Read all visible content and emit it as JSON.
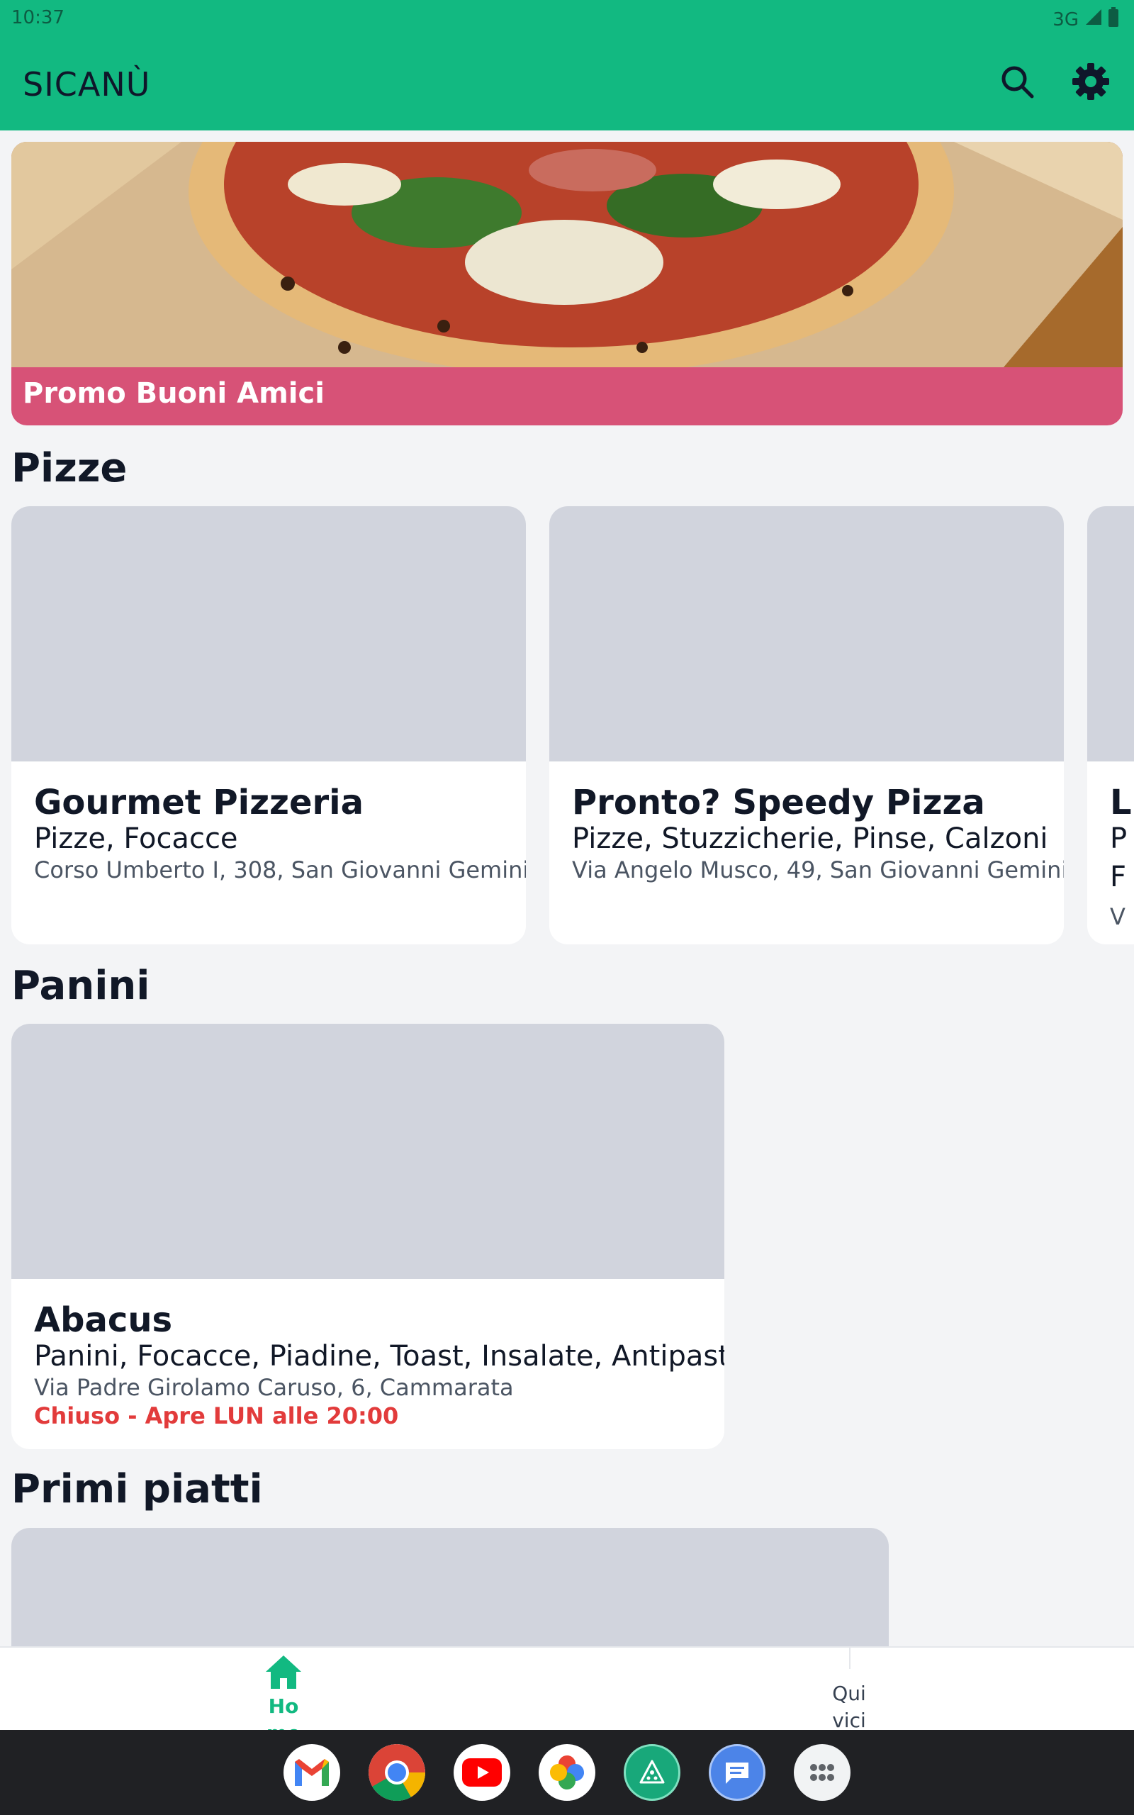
{
  "status_bar": {
    "time": "10:37",
    "network": "3G"
  },
  "app_bar": {
    "title": "SICANÙ",
    "search_icon": "search-icon",
    "settings_icon": "gear-icon"
  },
  "promo": {
    "label": "Promo Buoni Amici"
  },
  "sections": [
    {
      "title": "Pizze",
      "cards": [
        {
          "name": "Gourmet Pizzeria",
          "categories": "Pizze, Focacce",
          "address": "Corso Umberto I, 308, San Giovanni Gemini"
        },
        {
          "name": "Pronto? Speedy Pizza",
          "categories": "Pizze, Stuzzicherie, Pinse, Calzoni",
          "address": "Via Angelo Musco, 49, San Giovanni Gemini"
        },
        {
          "name": "L",
          "categories": "P",
          "categories2": "F",
          "address": "V"
        }
      ]
    },
    {
      "title": "Panini",
      "cards": [
        {
          "name": "Abacus",
          "categories": "Panini, Focacce, Piadine, Toast, Insalate, Antipasti",
          "address": "Via Padre Girolamo Caruso, 6, Cammarata",
          "status": "Chiuso - Apre LUN alle 20:00"
        }
      ]
    },
    {
      "title": "Primi piatti",
      "cards": []
    }
  ],
  "bottom_nav": {
    "home": {
      "label_line1": "Ho",
      "label_line2": "me"
    },
    "nearby": {
      "label_line1": "Qui",
      "label_line2": "vici"
    }
  },
  "colors": {
    "primary": "#12b981",
    "promo": "#d75277",
    "closed": "#e23b3b"
  },
  "dock": [
    "gmail-icon",
    "chrome-icon",
    "youtube-icon",
    "photos-icon",
    "pizza-app-icon",
    "messages-icon",
    "app-drawer-icon"
  ]
}
